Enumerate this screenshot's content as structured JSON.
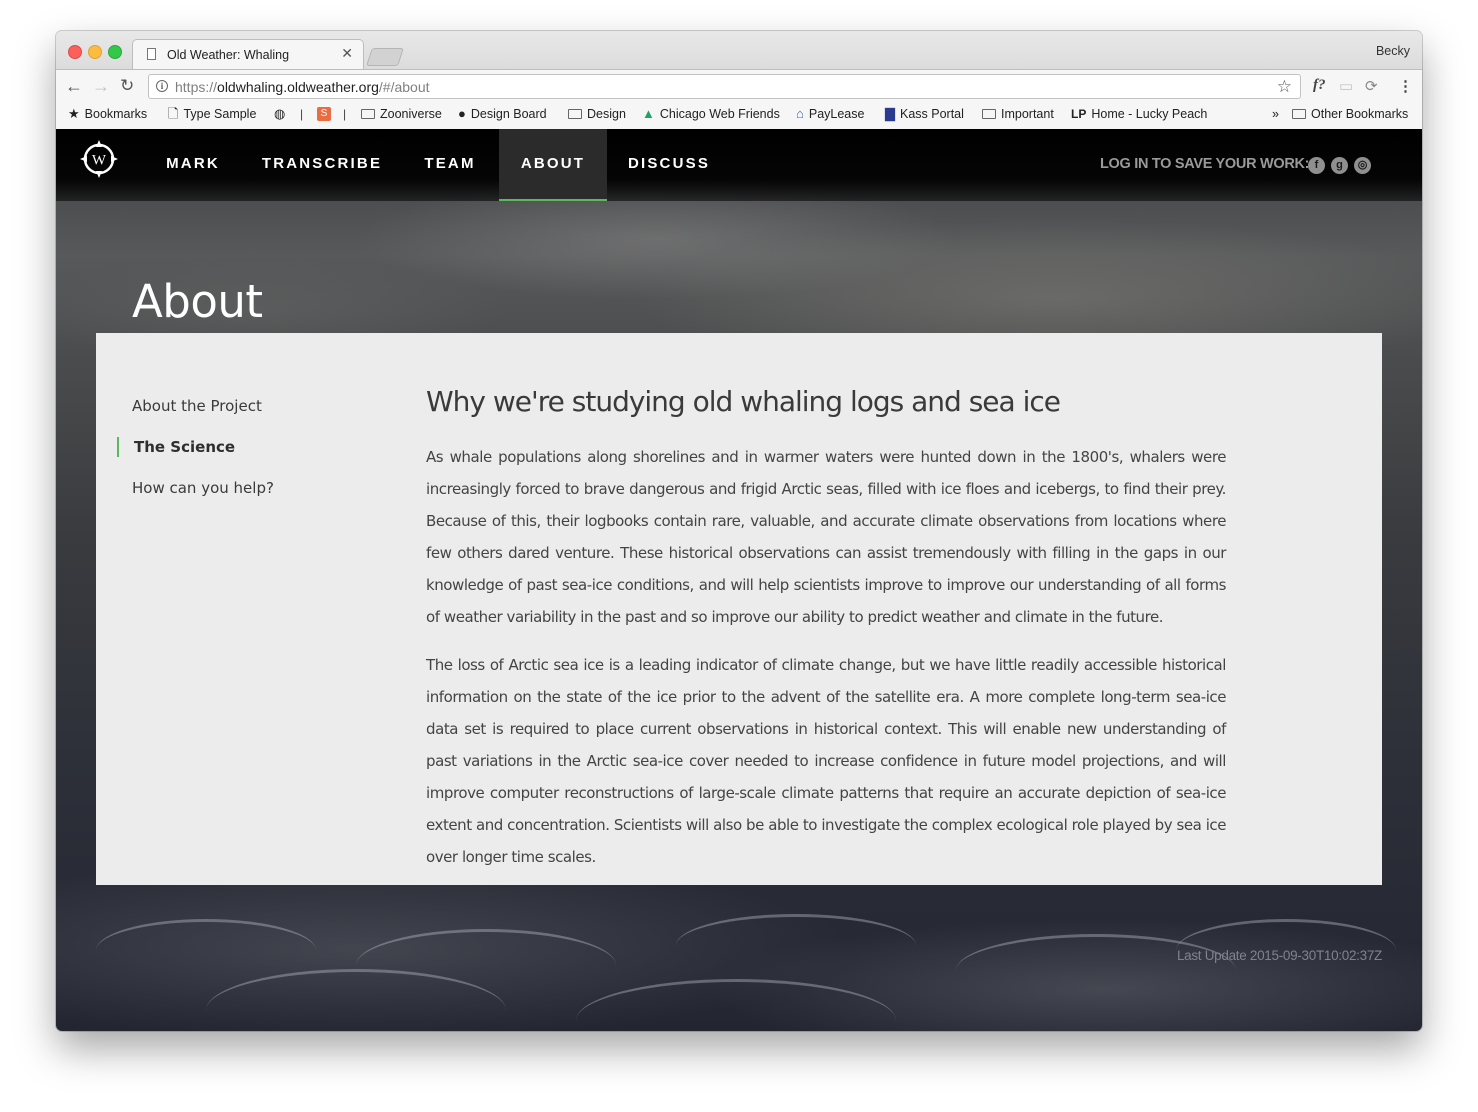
{
  "browser": {
    "tab_title": "Old Weather: Whaling",
    "profile_name": "Becky",
    "url_scheme": "https://",
    "url_host": "oldwhaling.oldweather.org",
    "url_path": "/#/about",
    "bookmarks": [
      {
        "label": "Bookmarks",
        "icon": "star-icon"
      },
      {
        "label": "Type Sample",
        "icon": "page-icon"
      },
      {
        "label": "Zooniverse",
        "icon": "folder-icon"
      },
      {
        "label": "Design Board",
        "icon": "github-icon"
      },
      {
        "label": "Design",
        "icon": "folder-icon"
      },
      {
        "label": "Chicago Web Friends",
        "icon": "drive-icon"
      },
      {
        "label": "PayLease",
        "icon": "house-icon"
      },
      {
        "label": "Kass Portal",
        "icon": "building-icon"
      },
      {
        "label": "Important",
        "icon": "folder-icon"
      },
      {
        "label": "Home - Lucky Peach",
        "icon": "lp-icon"
      }
    ],
    "other_bookmarks": "Other Bookmarks",
    "overflow": "»"
  },
  "site": {
    "logo_letter": "W",
    "nav": [
      {
        "label": "MARK",
        "active": false
      },
      {
        "label": "TRANSCRIBE",
        "active": false
      },
      {
        "label": "TEAM",
        "active": false
      },
      {
        "label": "ABOUT",
        "active": true
      },
      {
        "label": "DISCUSS",
        "active": false
      }
    ],
    "login_label": "LOG IN TO SAVE YOUR WORK:",
    "social": [
      {
        "icon": "facebook-icon",
        "glyph": "f"
      },
      {
        "icon": "google-icon",
        "glyph": "g"
      },
      {
        "icon": "zooniverse-icon",
        "glyph": "◎"
      }
    ],
    "accent_color": "#5cb85c"
  },
  "page": {
    "title": "About",
    "sidebar": [
      {
        "label": "About the Project",
        "active": false
      },
      {
        "label": "The Science",
        "active": true
      },
      {
        "label": "How can you help?",
        "active": false
      }
    ],
    "article_title": "Why we're studying old whaling logs and sea ice",
    "paragraphs": [
      "As whale populations along shorelines and in warmer waters were hunted down in the 1800's, whalers were increasingly forced to brave dangerous and frigid Arctic seas, filled with ice floes and icebergs, to find their prey. Because of this, their logbooks contain rare, valuable, and accurate climate observations from locations where few others dared venture. These historical observations can assist tremendously with filling in the gaps in our knowledge of past sea-ice conditions, and will help scientists improve to improve our understanding of all forms of weather variability in the past and so improve our ability to predict weather and climate in the future.",
      "The loss of Arctic sea ice is a leading indicator of climate change, but we have little readily accessible historical information on the state of the ice prior to the advent of the satellite era. A more complete long-term sea-ice data set is required to place current observations in historical context. This will enable new understanding of past variations in the Arctic sea-ice cover needed to increase confidence in future model projections, and will improve computer reconstructions of large-scale climate patterns that require an accurate depiction of sea-ice extent and concentration. Scientists will also be able to investigate the complex ecological role played by sea ice over longer time scales."
    ],
    "last_update": "Last Update 2015-09-30T10:02:37Z"
  }
}
